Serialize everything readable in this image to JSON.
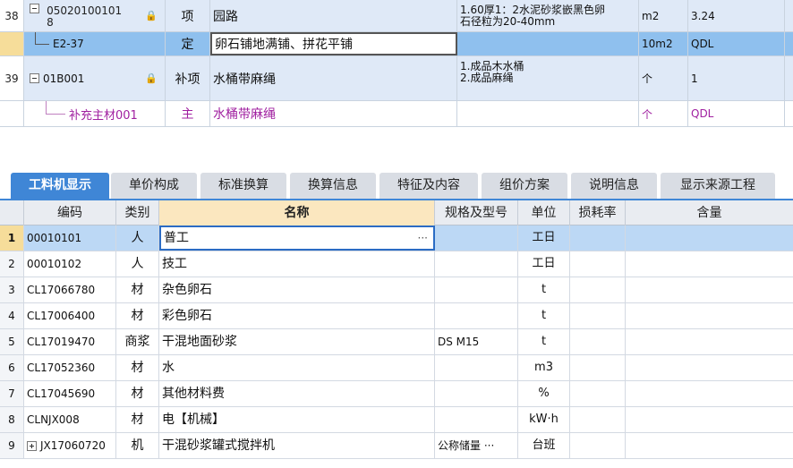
{
  "quota_rows": [
    {
      "row_no": "38",
      "code_line1": "05020100101",
      "code_line2": "8",
      "type": "项",
      "name": "园路",
      "features_line1": "1.60厚1：2水泥砂浆嵌黑色卵",
      "features_line2": "石径粒为20-40mm",
      "unit": "m2",
      "qty": "3.24"
    },
    {
      "row_no": "",
      "code": "E2-37",
      "type": "定",
      "name": "卵石铺地满铺、拼花平铺",
      "features": "",
      "unit": "10m2",
      "qty": "QDL"
    },
    {
      "row_no": "39",
      "code": "01B001",
      "type": "补项",
      "name": "水桶带麻绳",
      "features_line1": "1.成品木水桶",
      "features_line2": "2.成品麻绳",
      "unit": "个",
      "qty": "1"
    },
    {
      "row_no": "",
      "code": "补充主材001",
      "type": "主",
      "name": "水桶带麻绳",
      "features": "",
      "unit": "个",
      "qty": "QDL"
    }
  ],
  "tabs": [
    "工料机显示",
    "单价构成",
    "标准换算",
    "换算信息",
    "特征及内容",
    "组价方案",
    "说明信息",
    "显示来源工程"
  ],
  "columns": {
    "code": "编码",
    "category": "类别",
    "name": "名称",
    "spec": "规格及型号",
    "unit": "单位",
    "loss": "损耗率",
    "qty": "含量"
  },
  "materials": [
    {
      "no": "1",
      "code": "00010101",
      "category": "人",
      "name": "普工",
      "spec": "",
      "unit": "工日",
      "loss": "",
      "qty": "",
      "name_ellipsis": "···"
    },
    {
      "no": "2",
      "code": "00010102",
      "category": "人",
      "name": "技工",
      "spec": "",
      "unit": "工日",
      "loss": "",
      "qty": ""
    },
    {
      "no": "3",
      "code": "CL17066780",
      "category": "材",
      "name": "杂色卵石",
      "spec": "",
      "unit": "t",
      "loss": "",
      "qty": ""
    },
    {
      "no": "4",
      "code": "CL17006400",
      "category": "材",
      "name": "彩色卵石",
      "spec": "",
      "unit": "t",
      "loss": "",
      "qty": ""
    },
    {
      "no": "5",
      "code": "CL17019470",
      "category": "商浆",
      "name": "干混地面砂浆",
      "spec": "DS M15",
      "unit": "t",
      "loss": "",
      "qty": ""
    },
    {
      "no": "6",
      "code": "CL17052360",
      "category": "材",
      "name": "水",
      "spec": "",
      "unit": "m3",
      "loss": "",
      "qty": ""
    },
    {
      "no": "7",
      "code": "CL17045690",
      "category": "材",
      "name": "其他材料费",
      "spec": "",
      "unit": "%",
      "loss": "",
      "qty": ""
    },
    {
      "no": "8",
      "code": "CLNJX008",
      "category": "材",
      "name": "电【机械】",
      "spec": "",
      "unit": "kW·h",
      "loss": "",
      "qty": ""
    },
    {
      "no": "9",
      "code": "JX17060720",
      "category": "机",
      "name": "干混砂浆罐式搅拌机",
      "spec": "公称储量 ···",
      "unit": "台班",
      "loss": "",
      "qty": ""
    }
  ]
}
